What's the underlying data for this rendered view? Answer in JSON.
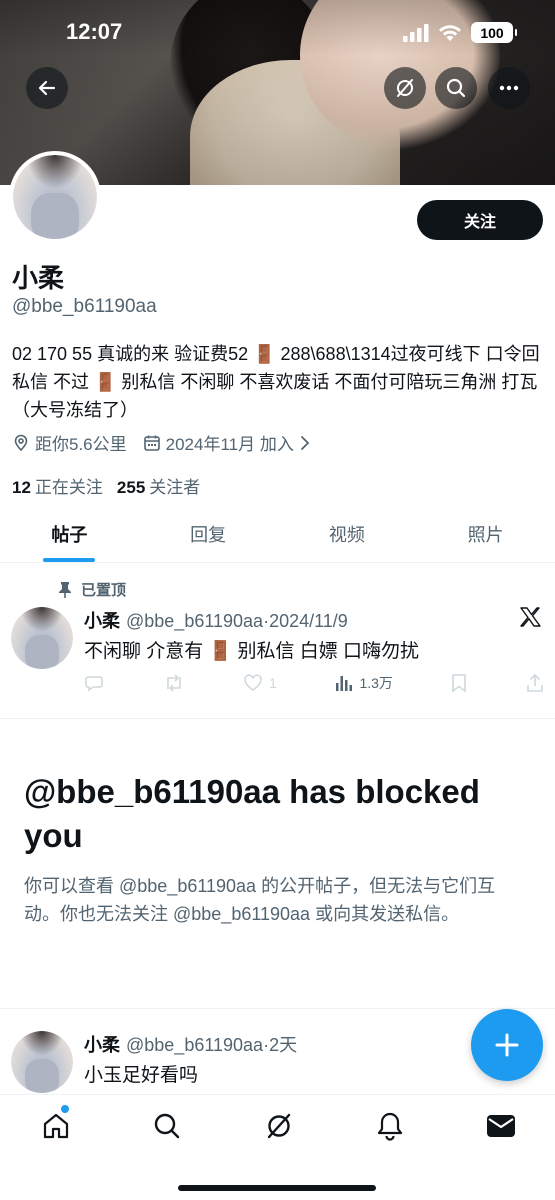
{
  "status_bar": {
    "time": "12:07",
    "battery": "100"
  },
  "profile": {
    "follow_label": "关注",
    "display_name": "小柔",
    "handle": "@bbe_b61190aa",
    "bio": "02 170 55 真诚的来 验证费52 🚪 288\\688\\1314过夜可线下 口令回私信 不过 🚪 别私信 不闲聊 不喜欢废话 不面付可陪玩三角洲 打瓦（大号冻结了）",
    "location": "距你5.6公里",
    "joined": "2024年11月 加入",
    "following_count": "12",
    "following_label": "正在关注",
    "followers_count": "255",
    "followers_label": "关注者"
  },
  "tabs": [
    {
      "label": "帖子"
    },
    {
      "label": "回复"
    },
    {
      "label": "视频"
    },
    {
      "label": "照片"
    }
  ],
  "pinned_post": {
    "pinned_label": "已置顶",
    "name": "小柔",
    "handle": "@bbe_b61190aa",
    "date": "2024/11/9",
    "text": "不闲聊 介意有 🚪 别私信 白嫖 口嗨勿扰",
    "likes": "1",
    "views": "1.3万"
  },
  "blocked": {
    "title": "@bbe_b61190aa has blocked you",
    "description": "你可以查看 @bbe_b61190aa 的公开帖子，但无法与它们互动。你也无法关注 @bbe_b61190aa 或向其发送私信。"
  },
  "second_post": {
    "name": "小柔",
    "handle": "@bbe_b61190aa",
    "date": "2天",
    "text": "小玉足好看吗"
  },
  "colors": {
    "accent": "#1d9bf0",
    "text": "#0f1419",
    "secondary": "#536471"
  },
  "icons": [
    "back-arrow-icon",
    "grok-icon",
    "search-icon",
    "more-icon",
    "location-icon",
    "calendar-icon",
    "chevron-right-icon",
    "pin-icon",
    "x-logo-icon",
    "reply-icon",
    "repost-icon",
    "like-icon",
    "views-icon",
    "bookmark-icon",
    "share-icon",
    "plus-icon",
    "home-icon",
    "bell-icon",
    "mail-icon"
  ]
}
